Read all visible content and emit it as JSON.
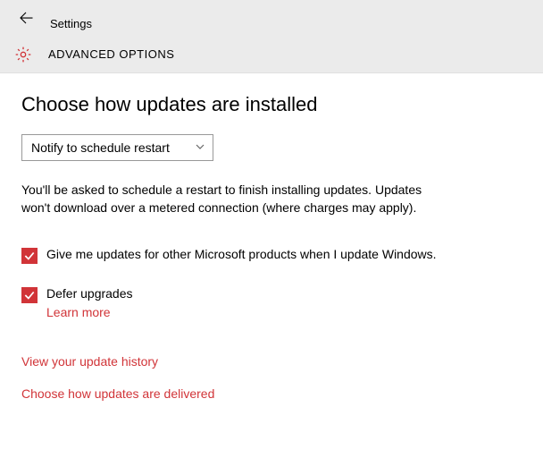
{
  "topbar": {
    "title": "Settings"
  },
  "subbar": {
    "title": "ADVANCED OPTIONS"
  },
  "main": {
    "heading": "Choose how updates are installed",
    "select": {
      "selected": "Notify to schedule restart"
    },
    "description": "You'll be asked to schedule a restart to finish installing updates. Updates won't download over a metered connection (where charges may apply).",
    "option1": {
      "label": "Give me updates for other Microsoft products when I update Windows.",
      "checked": true
    },
    "option2": {
      "label": "Defer upgrades",
      "checked": true,
      "learn_more": "Learn more"
    },
    "links": {
      "history": "View your update history",
      "delivery": "Choose how updates are delivered"
    }
  },
  "colors": {
    "accent": "#d13438"
  }
}
